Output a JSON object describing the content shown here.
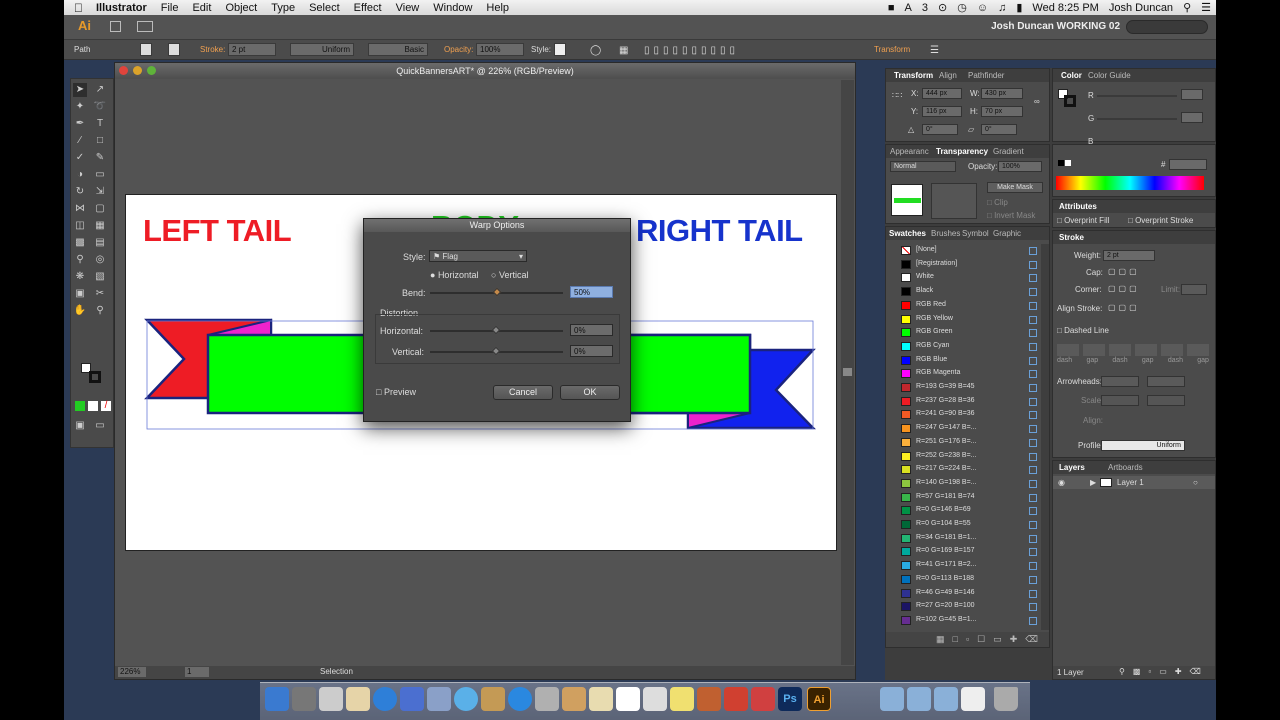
{
  "menubar": {
    "app": "Illustrator",
    "items": [
      "File",
      "Edit",
      "Object",
      "Type",
      "Select",
      "Effect",
      "View",
      "Window",
      "Help"
    ],
    "clock": "Wed 8:25 PM",
    "user": "Josh Duncan",
    "badge": "3"
  },
  "appbar": {
    "logo": "Ai",
    "workspace": "Josh Duncan WORKING 02"
  },
  "control": {
    "selection": "Path",
    "stroke_label": "Stroke:",
    "stroke_value": "2 pt",
    "profile": "Uniform",
    "brush": "Basic",
    "opacity_label": "Opacity:",
    "opacity_value": "100%",
    "style_label": "Style:",
    "transform": "Transform"
  },
  "document": {
    "title": "QuickBannersART* @ 226% (RGB/Preview)",
    "zoom": "226%",
    "page": "1",
    "status": "Selection"
  },
  "art": {
    "left": "LEFT TAIL",
    "body": "BODY",
    "right": "RIGHT TAIL",
    "colors": {
      "red": "#ee1c25",
      "green": "#00ff00",
      "blue": "#1122ee",
      "magenta": "#ee22cc",
      "navy": "#1a237e",
      "green_text": "#22cc22",
      "blue_text": "#1633cc"
    }
  },
  "dialog": {
    "title": "Warp Options",
    "style_label": "Style:",
    "style_value": "Flag",
    "horizontal": "Horizontal",
    "vertical": "Vertical",
    "bend_label": "Bend:",
    "bend_value": "50%",
    "bend": 0.5,
    "distortion_label": "Distortion",
    "dist_h_label": "Horizontal:",
    "dist_h_value": "0%",
    "dist_v_label": "Vertical:",
    "dist_v_value": "0%",
    "preview": "Preview",
    "cancel": "Cancel",
    "ok": "OK"
  },
  "transform": {
    "tabs": [
      "Transform",
      "Align",
      "Pathfinder"
    ],
    "x_label": "X:",
    "x": "444 px",
    "w_label": "W:",
    "w": "430 px",
    "y_label": "Y:",
    "y": "116 px",
    "h_label": "H:",
    "h": "70 px",
    "angle": "0°",
    "shear": "0°"
  },
  "color": {
    "tabs": [
      "Color",
      "Color Guide"
    ],
    "r": "R",
    "g": "G",
    "b": "B",
    "hash": "#"
  },
  "transparency": {
    "tabs": [
      "Appearanc",
      "Transparency",
      "Gradient"
    ],
    "mode": "Normal",
    "opacity_label": "Opacity:",
    "opacity": "100%",
    "make_mask": "Make Mask",
    "clip": "Clip",
    "invert": "Invert Mask"
  },
  "attributes": {
    "tab": "Attributes",
    "fill": "Overprint Fill",
    "stroke": "Overprint Stroke"
  },
  "stroke_panel": {
    "tab": "Stroke",
    "weight_label": "Weight:",
    "weight": "2 pt",
    "cap": "Cap:",
    "corner": "Corner:",
    "limit": "Limit:",
    "align": "Align Stroke:",
    "dashed": "Dashed Line",
    "dash_labels": [
      "dash",
      "gap",
      "dash",
      "gap",
      "dash",
      "gap"
    ],
    "arrowheads": "Arrowheads:",
    "scale": "Scale:",
    "align2": "Align:",
    "profile_label": "Profile:",
    "profile": "Uniform"
  },
  "swatches": {
    "tabs": [
      "Swatches",
      "Brushes",
      "Symbol",
      "Graphic"
    ],
    "items": [
      {
        "name": "[None]",
        "color": "#ffffff"
      },
      {
        "name": "[Registration]",
        "color": "#000000"
      },
      {
        "name": "White",
        "color": "#ffffff"
      },
      {
        "name": "Black",
        "color": "#000000"
      },
      {
        "name": "RGB Red",
        "color": "#ff0000"
      },
      {
        "name": "RGB Yellow",
        "color": "#ffff00"
      },
      {
        "name": "RGB Green",
        "color": "#00ff00"
      },
      {
        "name": "RGB Cyan",
        "color": "#00ffff"
      },
      {
        "name": "RGB Blue",
        "color": "#0000ff"
      },
      {
        "name": "RGB Magenta",
        "color": "#ff00ff"
      },
      {
        "name": "R=193 G=39 B=45",
        "color": "#c1272d"
      },
      {
        "name": "R=237 G=28 B=36",
        "color": "#ed1c24"
      },
      {
        "name": "R=241 G=90 B=36",
        "color": "#f15a24"
      },
      {
        "name": "R=247 G=147 B=...",
        "color": "#f7931e"
      },
      {
        "name": "R=251 G=176 B=...",
        "color": "#fbb03b"
      },
      {
        "name": "R=252 G=238 B=...",
        "color": "#fcee21"
      },
      {
        "name": "R=217 G=224 B=...",
        "color": "#d9e021"
      },
      {
        "name": "R=140 G=198 B=...",
        "color": "#8cc63f"
      },
      {
        "name": "R=57 G=181 B=74",
        "color": "#39b54a"
      },
      {
        "name": "R=0 G=146 B=69",
        "color": "#009245"
      },
      {
        "name": "R=0 G=104 B=55",
        "color": "#006837"
      },
      {
        "name": "R=34 G=181 B=1...",
        "color": "#22b573"
      },
      {
        "name": "R=0 G=169 B=157",
        "color": "#00a99d"
      },
      {
        "name": "R=41 G=171 B=2...",
        "color": "#29abe2"
      },
      {
        "name": "R=0 G=113 B=188",
        "color": "#0071bc"
      },
      {
        "name": "R=46 G=49 B=146",
        "color": "#2e3192"
      },
      {
        "name": "R=27 G=20 B=100",
        "color": "#1b1464"
      },
      {
        "name": "R=102 G=45 B=1...",
        "color": "#662d91"
      }
    ]
  },
  "layers": {
    "tabs": [
      "Layers",
      "Artboards"
    ],
    "layer": "Layer 1",
    "count": "1 Layer"
  }
}
